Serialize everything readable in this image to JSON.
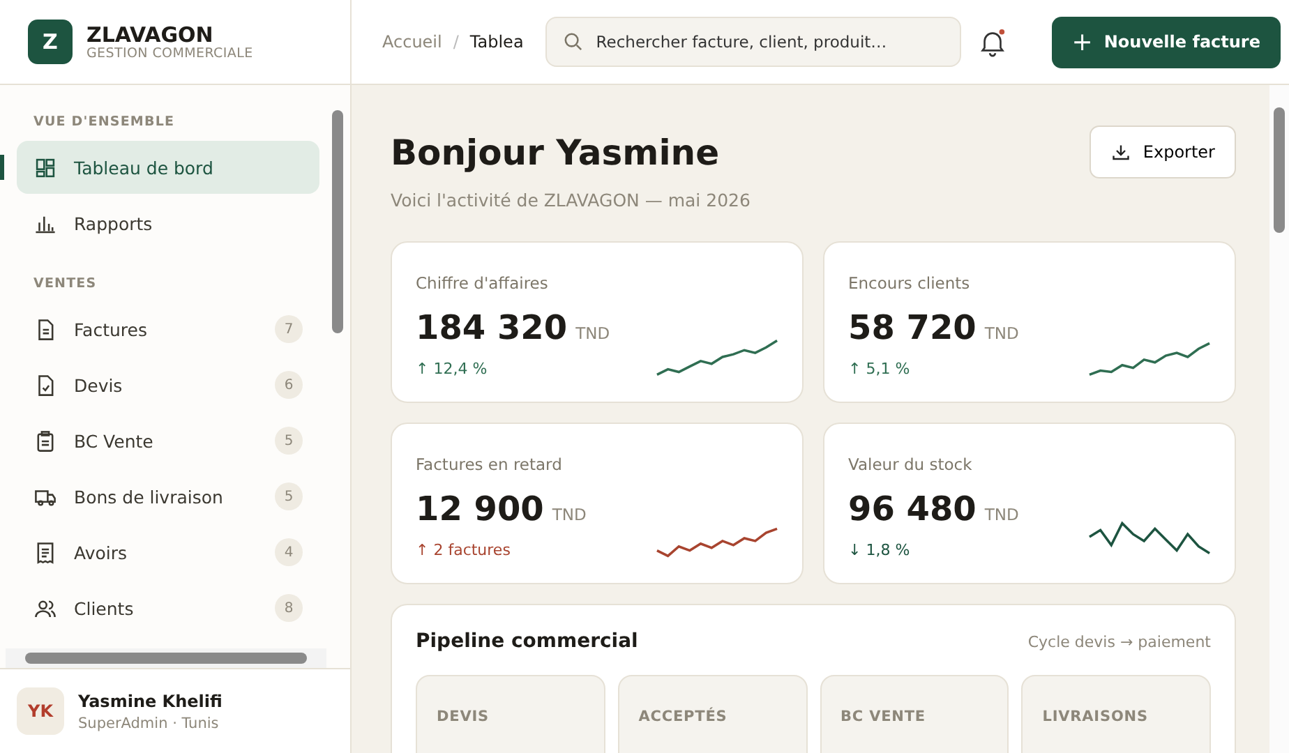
{
  "brand": {
    "logo_letter": "Z",
    "name": "ZLAVAGON",
    "tagline": "GESTION COMMERCIALE"
  },
  "sidebar": {
    "sections": [
      {
        "title": "VUE D'ENSEMBLE",
        "items": [
          {
            "label": "Tableau de bord",
            "selected": true
          },
          {
            "label": "Rapports",
            "selected": false
          }
        ]
      },
      {
        "title": "VENTES",
        "items": [
          {
            "label": "Factures",
            "count": "7",
            "selected": false
          },
          {
            "label": "Devis",
            "count": "6",
            "selected": false
          },
          {
            "label": "BC Vente",
            "count": "5",
            "selected": false
          },
          {
            "label": "Bons de livraison",
            "count": "5",
            "selected": false
          },
          {
            "label": "Avoirs",
            "count": "4",
            "selected": false
          },
          {
            "label": "Clients",
            "count": "8",
            "selected": false
          }
        ]
      }
    ]
  },
  "user": {
    "initials": "YK",
    "name": "Yasmine Khelifi",
    "role": "SuperAdmin · Tunis"
  },
  "breadcrumb": {
    "separator": "/",
    "items": [
      "Accueil",
      "Tablea"
    ]
  },
  "search": {
    "placeholder": "Rechercher facture, client, produit…"
  },
  "notifications": {
    "unread": true
  },
  "new_button": {
    "icon": "+",
    "label": "Nouvelle facture"
  },
  "header": {
    "title": "Bonjour Yasmine",
    "subtitle": "Voici l'activité de ZLAVAGON — mai 2026",
    "export_label": "Exporter"
  },
  "kpis": [
    {
      "label": "Chiffre d'affaires",
      "value": "184 320",
      "unit": "TND",
      "delta": "↑ 12,4 %",
      "color": "#2f6e52"
    },
    {
      "label": "Encours clients",
      "value": "58 720",
      "unit": "TND",
      "delta": "↑ 5,1 %",
      "color": "#2f6e52"
    },
    {
      "label": "Factures en retard",
      "value": "12 900",
      "unit": "TND",
      "delta": "↑ 2 factures",
      "color": "#a8442f"
    },
    {
      "label": "Valeur du stock",
      "value": "96 480",
      "unit": "TND",
      "delta": "↓ 1,8 %",
      "color": "#1d5440"
    }
  ],
  "pipeline": {
    "title": "Pipeline commercial",
    "note": "Cycle devis → paiement",
    "stages": [
      {
        "label": "DEVIS"
      },
      {
        "label": "ACCEPTÉS"
      },
      {
        "label": "BC VENTE"
      },
      {
        "label": "LIVRAISONS"
      }
    ]
  }
}
